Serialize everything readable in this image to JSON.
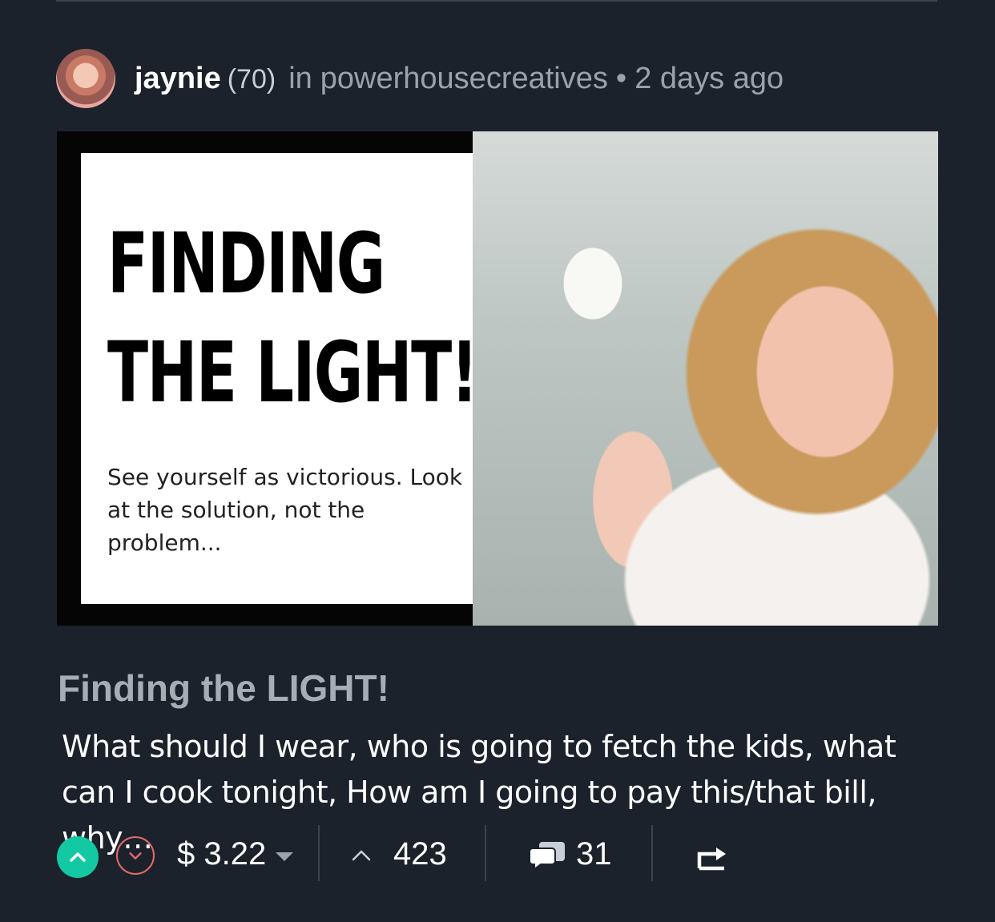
{
  "post": {
    "author": "jaynie",
    "reputation": "(70)",
    "in_word": "in",
    "community": "powerhousecreatives",
    "separator": "•",
    "time": "2 days ago",
    "thumbnail": {
      "headline_line1": "FINDING",
      "headline_line2": "THE LIGHT!",
      "subtext": "See yourself as victorious. Look at the solution, not the problem..."
    },
    "title": "Finding the LIGHT!",
    "summary": "What should I wear, who is going to fetch the kids, what can I cook tonight, How am I going to pay this/that bill, why…"
  },
  "footer": {
    "payout": "$ 3.22",
    "votes": "423",
    "comments": "31"
  },
  "colors": {
    "background": "#1b222b",
    "upvote": "#13c9a3",
    "downvote": "#e46a6a",
    "muted": "#9aa3ad"
  },
  "icons": [
    "upvote-icon",
    "downvote-icon",
    "chevron-down-icon",
    "votes-caret-icon",
    "comment-icon",
    "reblog-icon"
  ]
}
